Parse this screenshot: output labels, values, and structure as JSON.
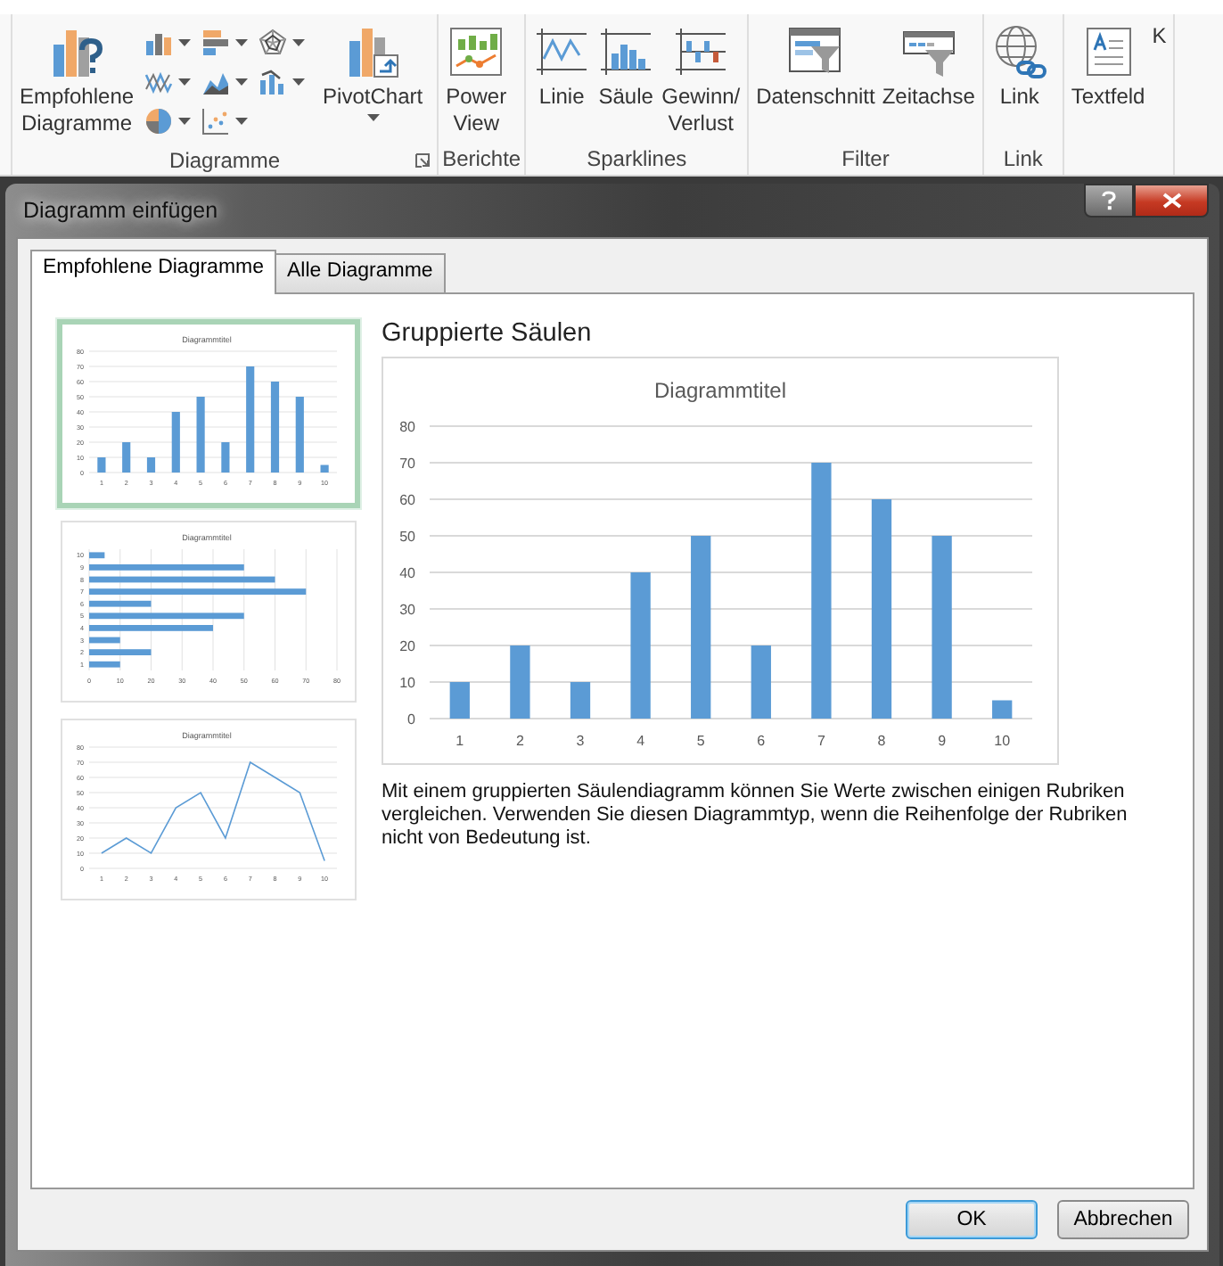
{
  "ribbon": {
    "groups": [
      {
        "label": "Diagramme",
        "launcher": true,
        "items": [
          {
            "kind": "large",
            "label": "Empfohlene\nDiagramme"
          },
          {
            "kind": "small",
            "caret": true
          },
          {
            "kind": "small",
            "caret": true
          },
          {
            "kind": "small",
            "caret": true
          },
          {
            "kind": "small",
            "caret": true
          },
          {
            "kind": "small",
            "caret": true
          },
          {
            "kind": "small",
            "caret": true
          },
          {
            "kind": "small",
            "caret": true
          },
          {
            "kind": "small",
            "caret": true
          },
          {
            "kind": "large",
            "label": "PivotChart",
            "caret": true
          }
        ]
      },
      {
        "label": "Berichte",
        "items": [
          {
            "kind": "large",
            "label": "Power\nView"
          }
        ]
      },
      {
        "label": "Sparklines",
        "items": [
          {
            "kind": "large",
            "label": "Linie"
          },
          {
            "kind": "large",
            "label": "Säule"
          },
          {
            "kind": "large",
            "label": "Gewinn/\nVerlust"
          }
        ]
      },
      {
        "label": "Filter",
        "items": [
          {
            "kind": "large",
            "label": "Datenschnitt"
          },
          {
            "kind": "large",
            "label": "Zeitachse"
          }
        ]
      },
      {
        "label": "Link",
        "items": [
          {
            "kind": "large",
            "label": "Link"
          }
        ]
      },
      {
        "items": [
          {
            "kind": "large",
            "label": "Textfeld"
          },
          {
            "kind": "large",
            "label": "K"
          }
        ]
      }
    ]
  },
  "dialog": {
    "title": "Diagramm einfügen",
    "tabs": [
      {
        "label": "Empfohlene Diagramme",
        "selected": true
      },
      {
        "label": "Alle Diagramme",
        "selected": false
      }
    ],
    "thumbnails": [
      {
        "selected": true,
        "chart_data": {
          "type": "bar",
          "title": "Diagrammtitel",
          "categories": [
            "1",
            "2",
            "3",
            "4",
            "5",
            "6",
            "7",
            "8",
            "9",
            "10"
          ],
          "values": [
            10,
            20,
            10,
            40,
            50,
            20,
            70,
            60,
            50,
            5
          ],
          "ylim": [
            0,
            80
          ],
          "yticks": [
            0,
            10,
            20,
            30,
            40,
            50,
            60,
            70,
            80
          ],
          "grid": true
        }
      },
      {
        "selected": false,
        "chart_data": {
          "type": "bar",
          "orientation": "horizontal",
          "title": "Diagrammtitel",
          "categories": [
            "10",
            "9",
            "8",
            "7",
            "6",
            "5",
            "4",
            "3",
            "2",
            "1"
          ],
          "values": [
            5,
            50,
            60,
            70,
            20,
            50,
            40,
            10,
            20,
            10
          ],
          "xlim": [
            0,
            80
          ],
          "xticks": [
            0,
            10,
            20,
            30,
            40,
            50,
            60,
            70,
            80
          ],
          "grid": true
        }
      },
      {
        "selected": false,
        "chart_data": {
          "type": "line",
          "title": "Diagrammtitel",
          "categories": [
            "1",
            "2",
            "3",
            "4",
            "5",
            "6",
            "7",
            "8",
            "9",
            "10"
          ],
          "values": [
            10,
            20,
            10,
            40,
            50,
            20,
            70,
            60,
            50,
            5
          ],
          "ylim": [
            0,
            80
          ],
          "yticks": [
            0,
            10,
            20,
            30,
            40,
            50,
            60,
            70,
            80
          ],
          "grid": true
        }
      }
    ],
    "preview": {
      "heading": "Gruppierte Säulen",
      "chart_data": {
        "type": "bar",
        "title": "Diagrammtitel",
        "categories": [
          "1",
          "2",
          "3",
          "4",
          "5",
          "6",
          "7",
          "8",
          "9",
          "10"
        ],
        "values": [
          10,
          20,
          10,
          40,
          50,
          20,
          70,
          60,
          50,
          5
        ],
        "ylim": [
          0,
          80
        ],
        "yticks": [
          0,
          10,
          20,
          30,
          40,
          50,
          60,
          70,
          80
        ],
        "grid": true
      },
      "description": "Mit einem gruppierten Säulendiagramm können Sie Werte zwischen einigen Rubriken vergleichen. Verwenden Sie diesen Diagrammtyp, wenn die Reihenfolge der Rubriken nicht von Bedeutung ist."
    },
    "buttons": [
      {
        "label": "OK",
        "default": true
      },
      {
        "label": "Abbrechen",
        "default": false
      }
    ]
  }
}
